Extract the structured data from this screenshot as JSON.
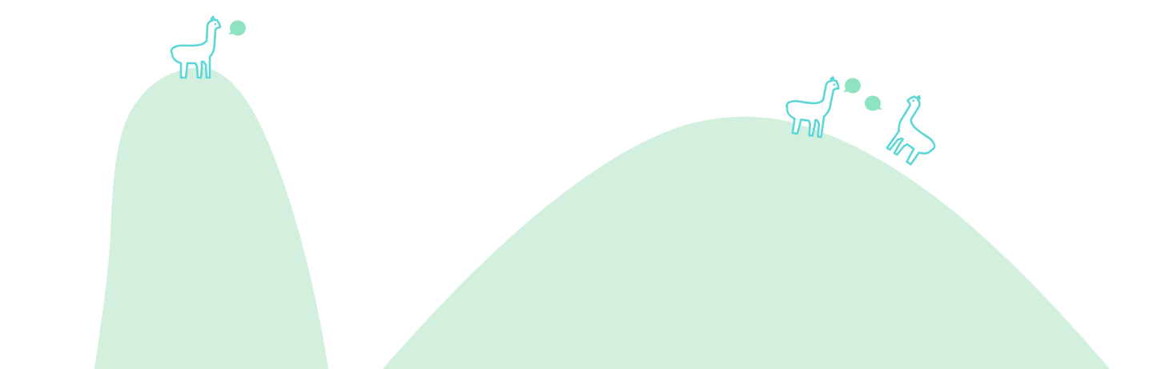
{
  "scene": {
    "background_color": "#ffffff",
    "hill_color": "#d3f0df",
    "llama_outline_color": "#5cd6d6",
    "speech_bubble_color": "#8ee3c1",
    "hills": [
      {
        "name": "left-hill"
      },
      {
        "name": "right-hill"
      }
    ],
    "llamas": [
      {
        "name": "llama-left-hilltop",
        "icon": "llama-icon",
        "bubble": "speech-bubble-icon"
      },
      {
        "name": "llama-right-hill-first",
        "icon": "llama-icon",
        "bubble": "speech-bubble-icon"
      },
      {
        "name": "llama-right-hill-second",
        "icon": "llama-icon",
        "bubble": "speech-bubble-icon"
      }
    ]
  }
}
